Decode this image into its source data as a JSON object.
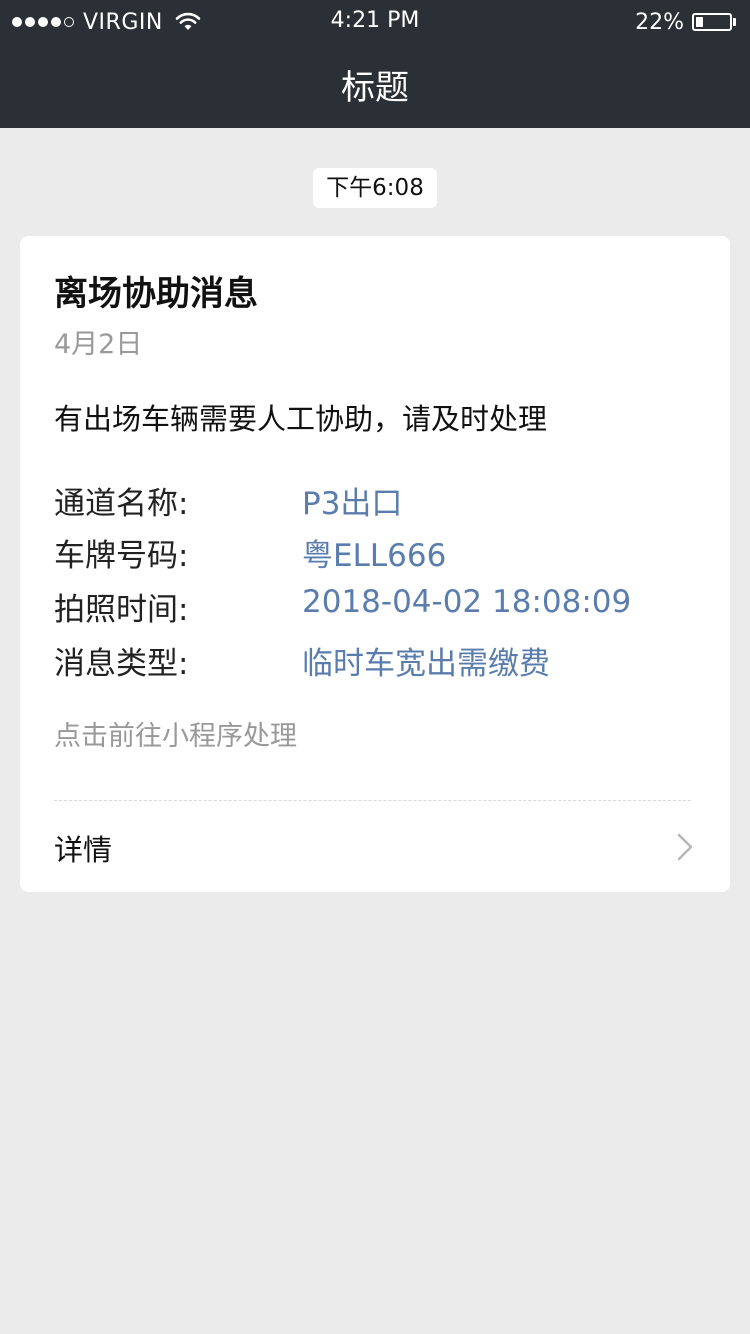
{
  "status_bar": {
    "carrier": "VIRGIN",
    "time": "4:21 PM",
    "battery": "22%",
    "battery_level": 0.22,
    "signal_bars_filled": 4,
    "signal_bars_total": 5
  },
  "header": {
    "title": "标题"
  },
  "message": {
    "timestamp": "下午6:08",
    "title": "离场协助消息",
    "date": "4月2日",
    "description": "有出场车辆需要人工协助，请及时处理",
    "fields": [
      {
        "label": "通道名称:",
        "value": "P3出口"
      },
      {
        "label": "车牌号码:",
        "value": "粤ELL666"
      },
      {
        "label": "拍照时间:",
        "value": "2018-04-02 18:08:09"
      },
      {
        "label": "消息类型:",
        "value": "临时车宽出需缴费"
      }
    ],
    "hint": "点击前往小程序处理",
    "detail_label": "详情"
  },
  "colors": {
    "header_bg": "#2b2f36",
    "page_bg": "#ebebeb",
    "value_blue": "#5a7dae"
  }
}
